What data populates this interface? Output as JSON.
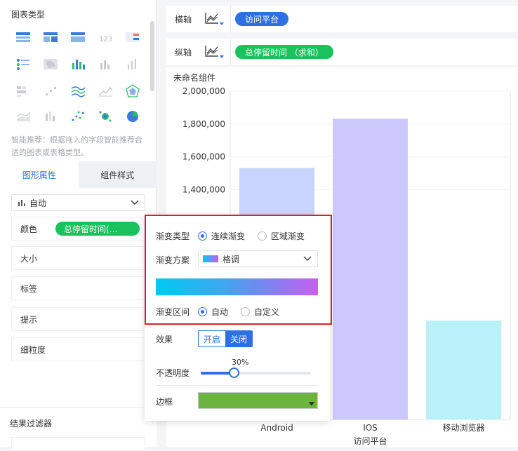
{
  "left": {
    "chart_type_title": "图表类型",
    "hint": "智能推荐：根据拖入的字段智能推荐合适的图表或表格类型。",
    "tabs": [
      "图形属性",
      "组件样式"
    ],
    "auto_select": "自动",
    "props": {
      "color_label": "颜色",
      "color_field": "总停留时间(…",
      "size": "大小",
      "label": "标签",
      "tooltip": "提示",
      "granularity": "细粒度"
    },
    "filter_title": "结果过滤器"
  },
  "axes": {
    "x_label": "横轴",
    "x_field": "访问平台",
    "y_label": "纵轴",
    "y_field": "总停留时间 （求和）"
  },
  "chart_title": "未命名组件",
  "popup": {
    "gradient_type_label": "渐变类型",
    "gradient_type_options": [
      "连续渐变",
      "区域渐变"
    ],
    "gradient_scheme_label": "渐变方案",
    "gradient_scheme_value": "格调",
    "gradient_range_label": "渐变区间",
    "gradient_range_options": [
      "自动",
      "自定义"
    ],
    "effect_label": "效果",
    "effect_on": "开启",
    "effect_off": "关闭",
    "opacity_label": "不透明度",
    "opacity_value": "30%",
    "opacity": 0.3,
    "border_label": "边框",
    "border_color": "#6db33f"
  },
  "chart_data": {
    "type": "bar",
    "categories": [
      "Android",
      "IOS",
      "移动浏览器"
    ],
    "values": [
      1530000,
      1830000,
      600000
    ],
    "xlabel": "访问平台",
    "ylabel": "",
    "ylim": [
      0,
      2000000
    ],
    "y_ticks": [
      "2,000,000",
      "1,800,000",
      "1,600,000",
      "1,400,000"
    ],
    "bar_colors": [
      "#c8d4fb",
      "#cdc8fb",
      "#b8f1f8"
    ]
  },
  "colors": {
    "accent": "#2f6fe4",
    "pill": "#19c25a",
    "highlight": "#e02020"
  }
}
